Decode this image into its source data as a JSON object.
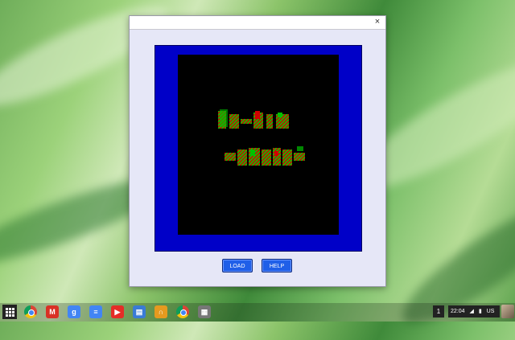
{
  "window": {
    "close_glyph": "×",
    "buttons": {
      "load": "LOAD",
      "help": "HELP"
    }
  },
  "emulator": {
    "frame_color": "#0000c8",
    "screen_color": "#000000"
  },
  "shelf": {
    "apps": [
      {
        "name": "chrome-icon",
        "glyph": "",
        "color": "#e0a020"
      },
      {
        "name": "gmail-icon",
        "glyph": "M",
        "color": "#d93025"
      },
      {
        "name": "google-search-icon",
        "glyph": "g",
        "color": "#4285f4"
      },
      {
        "name": "docs-icon",
        "glyph": "≡",
        "color": "#4285f4"
      },
      {
        "name": "youtube-icon",
        "glyph": "▶",
        "color": "#e52d27"
      },
      {
        "name": "files-icon",
        "glyph": "▤",
        "color": "#3a7bd5"
      },
      {
        "name": "headphones-icon",
        "glyph": "∩",
        "color": "#e69a1f"
      },
      {
        "name": "chrome-icon-2",
        "glyph": "",
        "color": "#e0a020"
      },
      {
        "name": "emulator-app-icon",
        "glyph": "▦",
        "color": "#777777"
      }
    ],
    "workspace_number": "1",
    "clock": "22:04",
    "ime": "US"
  }
}
